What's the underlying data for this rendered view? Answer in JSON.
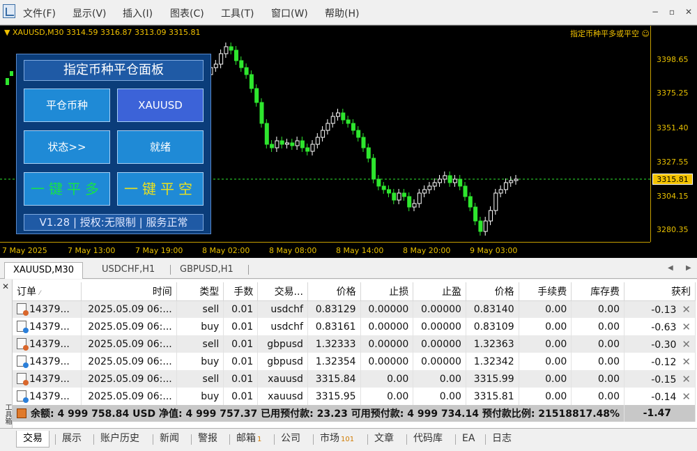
{
  "menu": [
    "文件(F)",
    "显示(V)",
    "插入(I)",
    "图表(C)",
    "工具(T)",
    "窗口(W)",
    "帮助(H)"
  ],
  "window_buttons": [
    "−",
    "▫",
    "✕"
  ],
  "chart": {
    "symbol_header": "▼ XAUUSD,M30  3314.59 3316.87 3313.09 3315.81",
    "ea_label": "指定币种平多或平空 ☺",
    "price_ticks": [
      "3398.65",
      "3375.25",
      "3351.40",
      "3327.55",
      "3304.15",
      "3280.35"
    ],
    "current_price": "3315.81",
    "time_ticks": [
      "7 May 2025",
      "7 May 13:00",
      "7 May 19:00",
      "8 May 02:00",
      "8 May 08:00",
      "8 May 14:00",
      "8 May 20:00",
      "9 May 03:00"
    ],
    "colors": {
      "background": "#000000",
      "bull": "#ffffff",
      "bear": "#2ee62e",
      "axis": "#e8c000",
      "bid_line": "#2ee62e"
    }
  },
  "panel": {
    "title": "指定币种平仓面板",
    "btn_close_symbol": "平仓币种",
    "btn_symbol_value": "XAUUSD",
    "btn_status": "状态>>",
    "btn_status_value": "就绪",
    "btn_close_long": "一键平多",
    "btn_close_short": "一键平空",
    "footer": "V1.28 | 授权:无限制 | 服务正常"
  },
  "chart_tabs": [
    "XAUUSD,M30",
    "USDCHF,H1",
    "GBPUSD,H1"
  ],
  "table": {
    "headers": [
      "订单",
      "时间",
      "类型",
      "手数",
      "交易...",
      "价格",
      "止损",
      "止盈",
      "价格",
      "手续费",
      "库存费",
      "获利"
    ],
    "rows": [
      {
        "order": "14379...",
        "time": "2025.05.09 06:...",
        "type": "sell",
        "lots": "0.01",
        "symbol": "usdchf",
        "price": "0.83129",
        "sl": "0.00000",
        "tp": "0.00000",
        "cur": "0.83140",
        "fee": "0.00",
        "swap": "0.00",
        "profit": "-0.13"
      },
      {
        "order": "14379...",
        "time": "2025.05.09 06:...",
        "type": "buy",
        "lots": "0.01",
        "symbol": "usdchf",
        "price": "0.83161",
        "sl": "0.00000",
        "tp": "0.00000",
        "cur": "0.83109",
        "fee": "0.00",
        "swap": "0.00",
        "profit": "-0.63"
      },
      {
        "order": "14379...",
        "time": "2025.05.09 06:...",
        "type": "sell",
        "lots": "0.01",
        "symbol": "gbpusd",
        "price": "1.32333",
        "sl": "0.00000",
        "tp": "0.00000",
        "cur": "1.32363",
        "fee": "0.00",
        "swap": "0.00",
        "profit": "-0.30"
      },
      {
        "order": "14379...",
        "time": "2025.05.09 06:...",
        "type": "buy",
        "lots": "0.01",
        "symbol": "gbpusd",
        "price": "1.32354",
        "sl": "0.00000",
        "tp": "0.00000",
        "cur": "1.32342",
        "fee": "0.00",
        "swap": "0.00",
        "profit": "-0.12"
      },
      {
        "order": "14379...",
        "time": "2025.05.09 06:...",
        "type": "sell",
        "lots": "0.01",
        "symbol": "xauusd",
        "price": "3315.84",
        "sl": "0.00",
        "tp": "0.00",
        "cur": "3315.99",
        "fee": "0.00",
        "swap": "0.00",
        "profit": "-0.15"
      },
      {
        "order": "14379...",
        "time": "2025.05.09 06:...",
        "type": "buy",
        "lots": "0.01",
        "symbol": "xauusd",
        "price": "3315.95",
        "sl": "0.00",
        "tp": "0.00",
        "cur": "3315.81",
        "fee": "0.00",
        "swap": "0.00",
        "profit": "-0.14"
      }
    ],
    "summary_text": "余额: 4 999 758.84 USD  净值: 4 999 757.37  已用预付款: 23.23  可用预付款: 4 999 734.14  预付款比例: 21518817.48%",
    "summary_profit": "-1.47"
  },
  "side_strip_label": "工具箱",
  "bottom_tabs": [
    {
      "label": "交易",
      "badge": ""
    },
    {
      "label": "展示",
      "badge": ""
    },
    {
      "label": "账户历史",
      "badge": ""
    },
    {
      "label": "新闻",
      "badge": ""
    },
    {
      "label": "警报",
      "badge": ""
    },
    {
      "label": "邮箱",
      "badge": "1"
    },
    {
      "label": "公司",
      "badge": ""
    },
    {
      "label": "市场",
      "badge": "101"
    },
    {
      "label": "文章",
      "badge": ""
    },
    {
      "label": "代码库",
      "badge": ""
    },
    {
      "label": "EA",
      "badge": ""
    },
    {
      "label": "日志",
      "badge": ""
    }
  ]
}
